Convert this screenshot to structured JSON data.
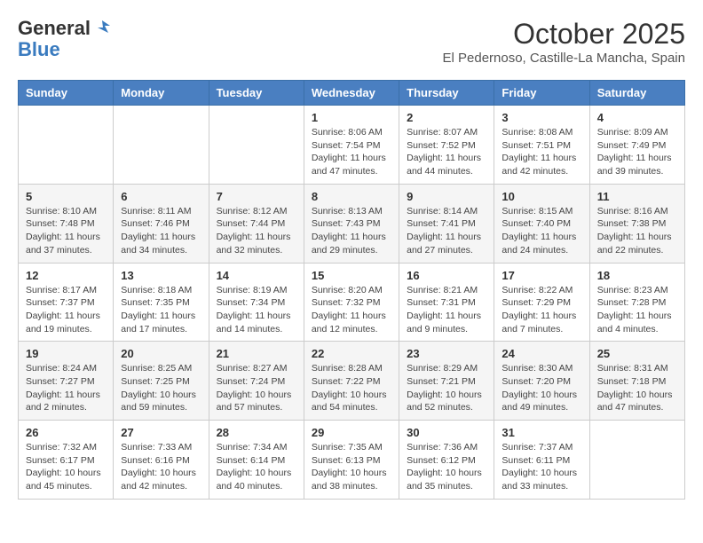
{
  "header": {
    "logo_general": "General",
    "logo_blue": "Blue",
    "month_title": "October 2025",
    "subtitle": "El Pedernoso, Castille-La Mancha, Spain"
  },
  "weekdays": [
    "Sunday",
    "Monday",
    "Tuesday",
    "Wednesday",
    "Thursday",
    "Friday",
    "Saturday"
  ],
  "weeks": [
    [
      {
        "day": "",
        "info": ""
      },
      {
        "day": "",
        "info": ""
      },
      {
        "day": "",
        "info": ""
      },
      {
        "day": "1",
        "info": "Sunrise: 8:06 AM\nSunset: 7:54 PM\nDaylight: 11 hours and 47 minutes."
      },
      {
        "day": "2",
        "info": "Sunrise: 8:07 AM\nSunset: 7:52 PM\nDaylight: 11 hours and 44 minutes."
      },
      {
        "day": "3",
        "info": "Sunrise: 8:08 AM\nSunset: 7:51 PM\nDaylight: 11 hours and 42 minutes."
      },
      {
        "day": "4",
        "info": "Sunrise: 8:09 AM\nSunset: 7:49 PM\nDaylight: 11 hours and 39 minutes."
      }
    ],
    [
      {
        "day": "5",
        "info": "Sunrise: 8:10 AM\nSunset: 7:48 PM\nDaylight: 11 hours and 37 minutes."
      },
      {
        "day": "6",
        "info": "Sunrise: 8:11 AM\nSunset: 7:46 PM\nDaylight: 11 hours and 34 minutes."
      },
      {
        "day": "7",
        "info": "Sunrise: 8:12 AM\nSunset: 7:44 PM\nDaylight: 11 hours and 32 minutes."
      },
      {
        "day": "8",
        "info": "Sunrise: 8:13 AM\nSunset: 7:43 PM\nDaylight: 11 hours and 29 minutes."
      },
      {
        "day": "9",
        "info": "Sunrise: 8:14 AM\nSunset: 7:41 PM\nDaylight: 11 hours and 27 minutes."
      },
      {
        "day": "10",
        "info": "Sunrise: 8:15 AM\nSunset: 7:40 PM\nDaylight: 11 hours and 24 minutes."
      },
      {
        "day": "11",
        "info": "Sunrise: 8:16 AM\nSunset: 7:38 PM\nDaylight: 11 hours and 22 minutes."
      }
    ],
    [
      {
        "day": "12",
        "info": "Sunrise: 8:17 AM\nSunset: 7:37 PM\nDaylight: 11 hours and 19 minutes."
      },
      {
        "day": "13",
        "info": "Sunrise: 8:18 AM\nSunset: 7:35 PM\nDaylight: 11 hours and 17 minutes."
      },
      {
        "day": "14",
        "info": "Sunrise: 8:19 AM\nSunset: 7:34 PM\nDaylight: 11 hours and 14 minutes."
      },
      {
        "day": "15",
        "info": "Sunrise: 8:20 AM\nSunset: 7:32 PM\nDaylight: 11 hours and 12 minutes."
      },
      {
        "day": "16",
        "info": "Sunrise: 8:21 AM\nSunset: 7:31 PM\nDaylight: 11 hours and 9 minutes."
      },
      {
        "day": "17",
        "info": "Sunrise: 8:22 AM\nSunset: 7:29 PM\nDaylight: 11 hours and 7 minutes."
      },
      {
        "day": "18",
        "info": "Sunrise: 8:23 AM\nSunset: 7:28 PM\nDaylight: 11 hours and 4 minutes."
      }
    ],
    [
      {
        "day": "19",
        "info": "Sunrise: 8:24 AM\nSunset: 7:27 PM\nDaylight: 11 hours and 2 minutes."
      },
      {
        "day": "20",
        "info": "Sunrise: 8:25 AM\nSunset: 7:25 PM\nDaylight: 10 hours and 59 minutes."
      },
      {
        "day": "21",
        "info": "Sunrise: 8:27 AM\nSunset: 7:24 PM\nDaylight: 10 hours and 57 minutes."
      },
      {
        "day": "22",
        "info": "Sunrise: 8:28 AM\nSunset: 7:22 PM\nDaylight: 10 hours and 54 minutes."
      },
      {
        "day": "23",
        "info": "Sunrise: 8:29 AM\nSunset: 7:21 PM\nDaylight: 10 hours and 52 minutes."
      },
      {
        "day": "24",
        "info": "Sunrise: 8:30 AM\nSunset: 7:20 PM\nDaylight: 10 hours and 49 minutes."
      },
      {
        "day": "25",
        "info": "Sunrise: 8:31 AM\nSunset: 7:18 PM\nDaylight: 10 hours and 47 minutes."
      }
    ],
    [
      {
        "day": "26",
        "info": "Sunrise: 7:32 AM\nSunset: 6:17 PM\nDaylight: 10 hours and 45 minutes."
      },
      {
        "day": "27",
        "info": "Sunrise: 7:33 AM\nSunset: 6:16 PM\nDaylight: 10 hours and 42 minutes."
      },
      {
        "day": "28",
        "info": "Sunrise: 7:34 AM\nSunset: 6:14 PM\nDaylight: 10 hours and 40 minutes."
      },
      {
        "day": "29",
        "info": "Sunrise: 7:35 AM\nSunset: 6:13 PM\nDaylight: 10 hours and 38 minutes."
      },
      {
        "day": "30",
        "info": "Sunrise: 7:36 AM\nSunset: 6:12 PM\nDaylight: 10 hours and 35 minutes."
      },
      {
        "day": "31",
        "info": "Sunrise: 7:37 AM\nSunset: 6:11 PM\nDaylight: 10 hours and 33 minutes."
      },
      {
        "day": "",
        "info": ""
      }
    ]
  ]
}
